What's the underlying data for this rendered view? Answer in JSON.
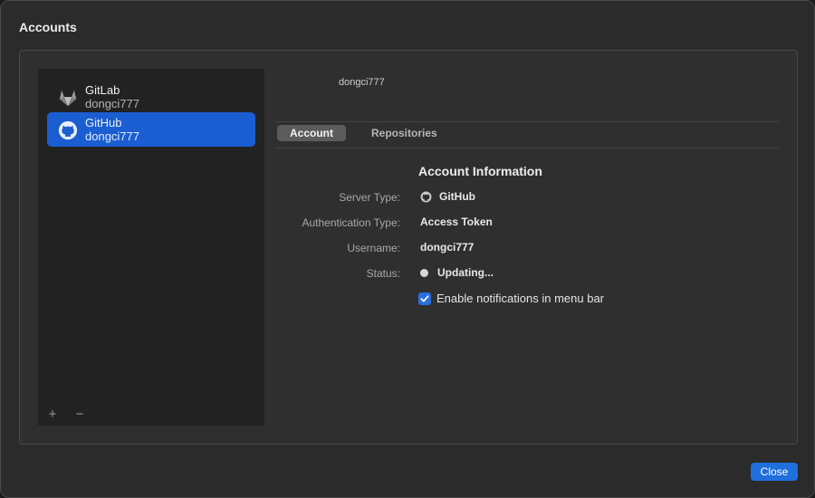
{
  "window": {
    "title": "Accounts"
  },
  "sidebar": {
    "accounts": [
      {
        "name": "GitLab",
        "user": "dongci777",
        "icon": "gitlab-icon",
        "selected": false
      },
      {
        "name": "GitHub",
        "user": "dongci777",
        "icon": "github-icon",
        "selected": true
      }
    ],
    "add_label": "+",
    "remove_label": "−"
  },
  "detail": {
    "header_user": "dongci777",
    "tabs": [
      {
        "label": "Account",
        "active": true
      },
      {
        "label": "Repositories",
        "active": false
      }
    ],
    "section_title": "Account Information",
    "rows": [
      {
        "label": "Server Type:",
        "value": "GitHub",
        "icon": "github-icon"
      },
      {
        "label": "Authentication Type:",
        "value": "Access Token"
      },
      {
        "label": "Username:",
        "value": "dongci777"
      },
      {
        "label": "Status:",
        "value": "Updating...",
        "icon": "status-dot-icon"
      }
    ],
    "notifications": {
      "label": "Enable notifications in menu bar",
      "checked": true
    }
  },
  "footer": {
    "close_label": "Close"
  },
  "colors": {
    "accent": "#1a5ed1",
    "checkbox": "#2a6fe0",
    "button": "#1f6fdc"
  }
}
